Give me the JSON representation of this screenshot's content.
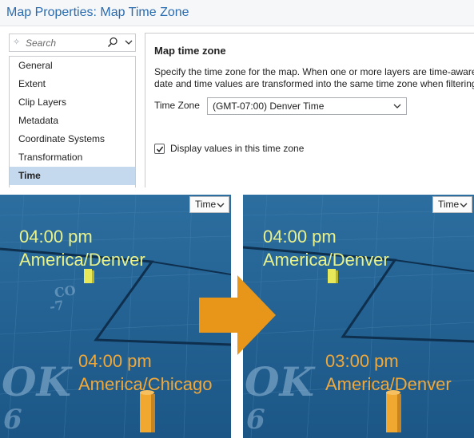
{
  "dialog": {
    "title": "Map Properties: Map Time Zone",
    "search": {
      "placeholder": "Search"
    },
    "nav": [
      "General",
      "Extent",
      "Clip Layers",
      "Metadata",
      "Coordinate Systems",
      "Transformation",
      "Time"
    ],
    "selected_nav": "Time",
    "panel": {
      "heading": "Map time zone",
      "desc_line1": "Specify the time zone for the map. When one or more layers are time-aware",
      "desc_line2": "date and time values are transformed into the same time zone when filtering",
      "tz_label": "Time Zone",
      "tz_value": "(GMT-07:00) Denver Time",
      "checkbox_label": "Display values in this time zone",
      "checkbox_checked": true
    }
  },
  "maps": {
    "left": {
      "time_button": "Time",
      "top_time": "04:00 pm",
      "top_zone": "America/Denver",
      "bottom_time": "04:00 pm",
      "bottom_zone": "America/Chicago",
      "state_top": "CO",
      "state_num": "-7",
      "state_bottom": "OK",
      "state_bottom_num": "6"
    },
    "right": {
      "time_button": "Time",
      "top_time": "04:00 pm",
      "top_zone": "America/Denver",
      "bottom_time": "03:00 pm",
      "bottom_zone": "America/Denver",
      "state_bottom": "OK",
      "state_bottom_num": "6"
    }
  },
  "colors": {
    "accent": "#2a6cb0",
    "selected": "#c5d9ee",
    "map_blue": "#1f5e8e",
    "label_yellow": "#e9f28a",
    "label_orange": "#f0a83a",
    "arrow": "#e8961a"
  }
}
